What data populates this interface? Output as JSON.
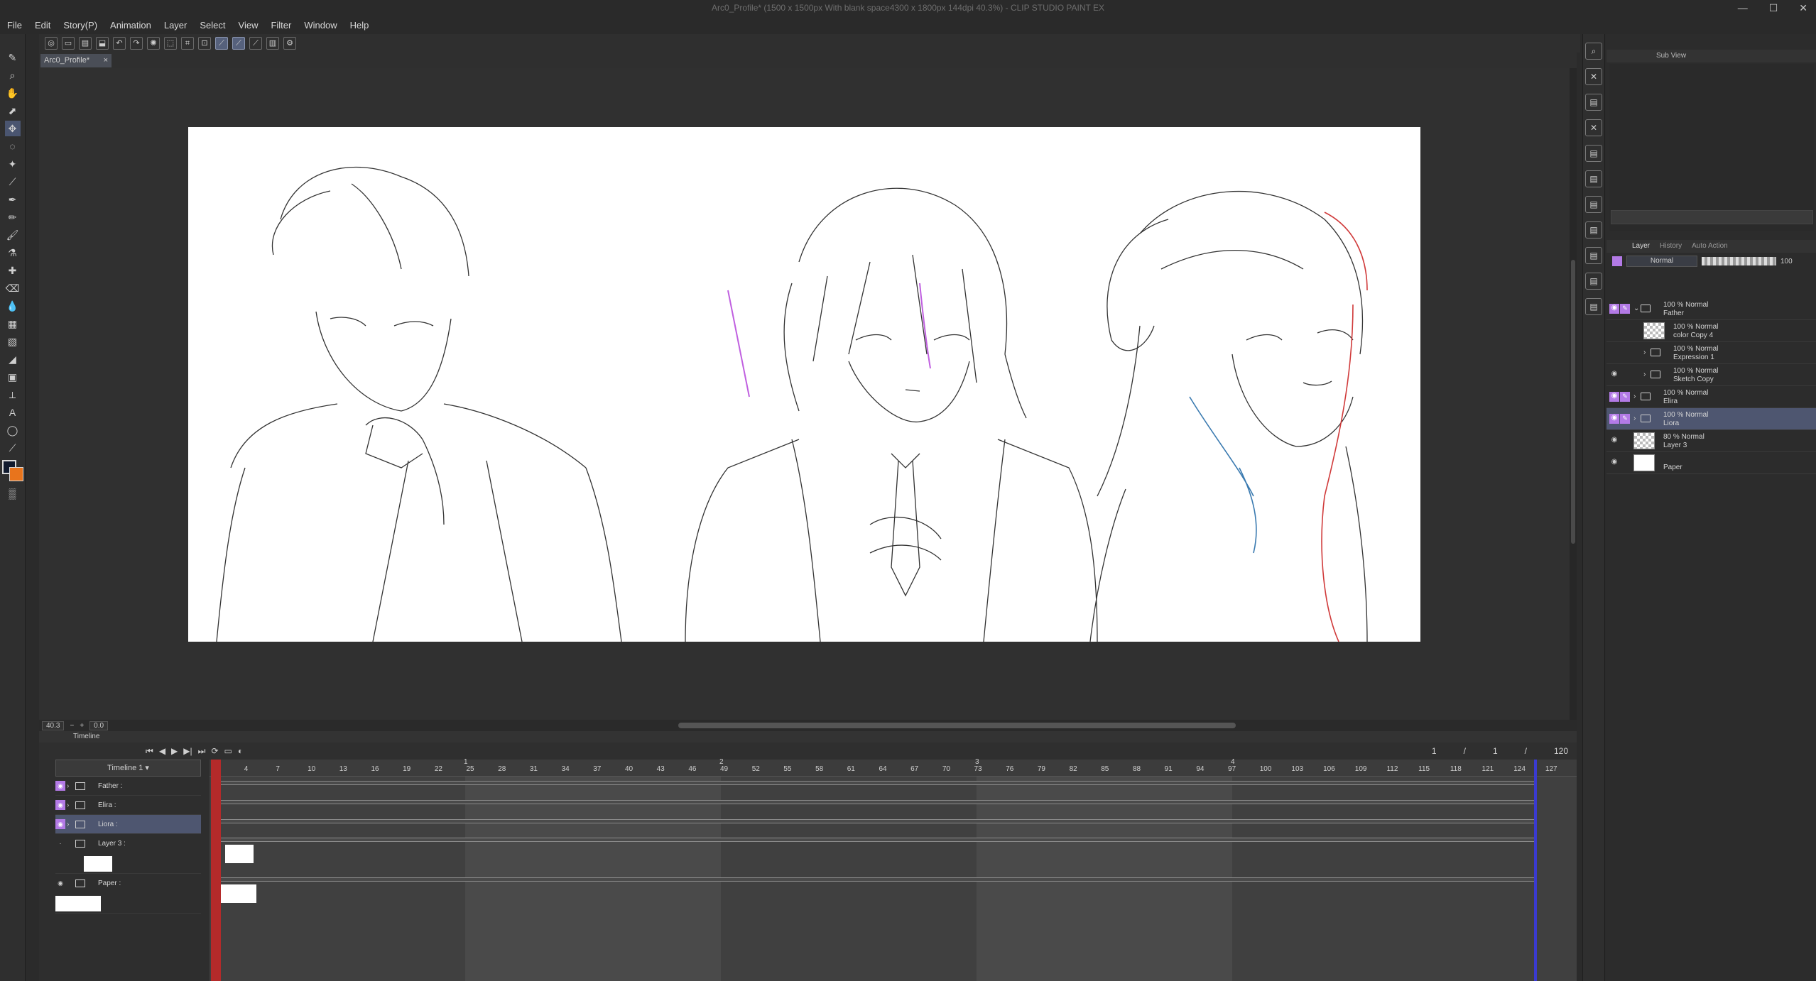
{
  "window": {
    "title": "Arc0_Profile* (1500 x 1500px With blank space4300 x 1800px 144dpi 40.3%) - CLIP STUDIO PAINT EX",
    "controls": [
      "—",
      "☐",
      "✕"
    ]
  },
  "menu": [
    "File",
    "Edit",
    "Story(P)",
    "Animation",
    "Layer",
    "Select",
    "View",
    "Filter",
    "Window",
    "Help"
  ],
  "document_tab": {
    "name": "Arc0_Profile*",
    "close": "×"
  },
  "canvas_status": {
    "zoom": "40.3",
    "angle": "0.0"
  },
  "right_panel": {
    "subview_tab": "Sub View",
    "layer_tabs": [
      "Layer",
      "History",
      "Auto Action"
    ],
    "blend_mode": "Normal",
    "opacity": "100",
    "layers": [
      {
        "pct": "100 % Normal",
        "name": "Father",
        "type": "folder",
        "eye": true,
        "edit": true,
        "expanded": true,
        "indent": 0
      },
      {
        "pct": "100 % Normal",
        "name": "color Copy 4",
        "type": "raster",
        "eye": false,
        "edit": false,
        "indent": 1
      },
      {
        "pct": "100 % Normal",
        "name": "Expression 1",
        "type": "folder",
        "eye": false,
        "edit": false,
        "indent": 1
      },
      {
        "pct": "100 % Normal",
        "name": "Sketch Copy",
        "type": "folder",
        "eye": true,
        "edit": false,
        "indent": 1
      },
      {
        "pct": "100 % Normal",
        "name": "Elira",
        "type": "folder",
        "eye": true,
        "edit": true,
        "indent": 0
      },
      {
        "pct": "100 % Normal",
        "name": "Liora",
        "type": "folder",
        "eye": true,
        "edit": true,
        "indent": 0,
        "selected": true
      },
      {
        "pct": "80 % Normal",
        "name": "Layer 3",
        "type": "raster",
        "eye": true,
        "edit": false,
        "indent": 0
      },
      {
        "pct": "",
        "name": "Paper",
        "type": "paper",
        "eye": true,
        "edit": false,
        "indent": 0
      }
    ]
  },
  "timeline": {
    "tab": "Timeline",
    "name": "Timeline 1",
    "current_frame": "1",
    "page_sep": "/",
    "page": "1",
    "total_frames": "120",
    "tracks": [
      {
        "name": "Father :",
        "type": "folder"
      },
      {
        "name": "Elira :",
        "type": "folder"
      },
      {
        "name": "Liora :",
        "type": "folder",
        "selected": true
      },
      {
        "name": "Layer 3 :",
        "type": "raster"
      },
      {
        "name": "Paper :",
        "type": "paper"
      }
    ],
    "ticks": [
      "1",
      "4",
      "7",
      "10",
      "13",
      "16",
      "19",
      "22",
      "25",
      "28",
      "31",
      "34",
      "37",
      "40",
      "43",
      "46",
      "49",
      "52",
      "55",
      "58",
      "61",
      "64",
      "67",
      "70",
      "73",
      "76",
      "79",
      "82",
      "85",
      "88",
      "91",
      "94",
      "97",
      "100",
      "103",
      "106",
      "109",
      "112",
      "115",
      "118",
      "121",
      "124",
      "127"
    ],
    "seconds": [
      "1",
      "2",
      "3",
      "4"
    ]
  },
  "colors": {
    "accent": "#b37ae6",
    "selection": "#4e5670",
    "playhead": "#b42a2a",
    "main_color": "#101a2e",
    "sub_color": "#e8741c"
  }
}
